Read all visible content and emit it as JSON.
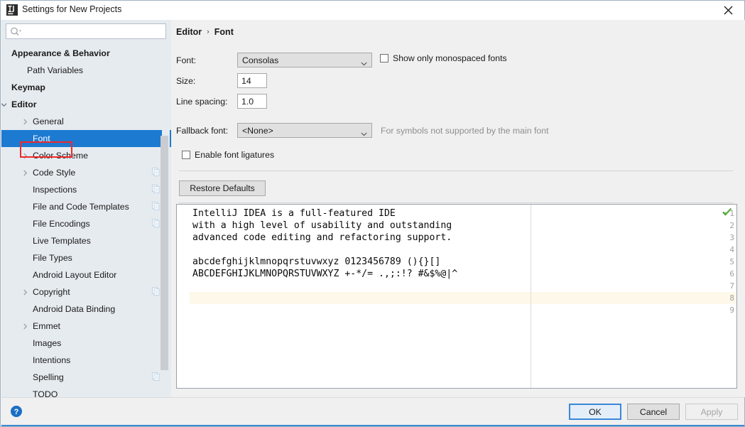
{
  "window": {
    "title": "Settings for New Projects",
    "app_icon": "intellij-idea-icon",
    "close_label": "✕"
  },
  "search": {
    "value": "",
    "placeholder": "",
    "icon": "search-icon"
  },
  "sidebar": {
    "items": [
      {
        "label": "Appearance & Behavior",
        "indent": 14,
        "bold": true,
        "arrow": "",
        "badge": false,
        "selected": false
      },
      {
        "label": "Path Variables",
        "indent": 36,
        "bold": false,
        "arrow": "",
        "badge": false,
        "selected": false
      },
      {
        "label": "Keymap",
        "indent": 14,
        "bold": true,
        "arrow": "",
        "badge": false,
        "selected": false
      },
      {
        "label": "Editor",
        "indent": 14,
        "bold": true,
        "arrow": "down",
        "badge": false,
        "selected": false
      },
      {
        "label": "General",
        "indent": 44,
        "bold": false,
        "arrow": "right",
        "badge": false,
        "selected": false
      },
      {
        "label": "Font",
        "indent": 44,
        "bold": false,
        "arrow": "",
        "badge": false,
        "selected": true
      },
      {
        "label": "Color Scheme",
        "indent": 44,
        "bold": false,
        "arrow": "right",
        "badge": false,
        "selected": false
      },
      {
        "label": "Code Style",
        "indent": 44,
        "bold": false,
        "arrow": "right",
        "badge": true,
        "selected": false
      },
      {
        "label": "Inspections",
        "indent": 44,
        "bold": false,
        "arrow": "",
        "badge": true,
        "selected": false
      },
      {
        "label": "File and Code Templates",
        "indent": 44,
        "bold": false,
        "arrow": "",
        "badge": true,
        "selected": false
      },
      {
        "label": "File Encodings",
        "indent": 44,
        "bold": false,
        "arrow": "",
        "badge": true,
        "selected": false
      },
      {
        "label": "Live Templates",
        "indent": 44,
        "bold": false,
        "arrow": "",
        "badge": false,
        "selected": false
      },
      {
        "label": "File Types",
        "indent": 44,
        "bold": false,
        "arrow": "",
        "badge": false,
        "selected": false
      },
      {
        "label": "Android Layout Editor",
        "indent": 44,
        "bold": false,
        "arrow": "",
        "badge": false,
        "selected": false
      },
      {
        "label": "Copyright",
        "indent": 44,
        "bold": false,
        "arrow": "right",
        "badge": true,
        "selected": false
      },
      {
        "label": "Android Data Binding",
        "indent": 44,
        "bold": false,
        "arrow": "",
        "badge": false,
        "selected": false
      },
      {
        "label": "Emmet",
        "indent": 44,
        "bold": false,
        "arrow": "right",
        "badge": false,
        "selected": false
      },
      {
        "label": "Images",
        "indent": 44,
        "bold": false,
        "arrow": "",
        "badge": false,
        "selected": false
      },
      {
        "label": "Intentions",
        "indent": 44,
        "bold": false,
        "arrow": "",
        "badge": false,
        "selected": false
      },
      {
        "label": "Spelling",
        "indent": 44,
        "bold": false,
        "arrow": "",
        "badge": true,
        "selected": false
      },
      {
        "label": "TODO",
        "indent": 44,
        "bold": false,
        "arrow": "",
        "badge": false,
        "selected": false
      }
    ]
  },
  "breadcrumb": {
    "root": "Editor",
    "separator": "›",
    "current": "Font"
  },
  "form": {
    "font_label": "Font:",
    "font_value": "Consolas",
    "monospaced_label": "Show only monospaced fonts",
    "monospaced_checked": false,
    "size_label": "Size:",
    "size_value": "14",
    "line_spacing_label": "Line spacing:",
    "line_spacing_value": "1.0",
    "fallback_label": "Fallback font:",
    "fallback_value": "<None>",
    "fallback_hint": "For symbols not supported by the main font",
    "ligatures_label": "Enable font ligatures",
    "ligatures_checked": false,
    "restore_defaults_label": "Restore Defaults"
  },
  "preview": {
    "line_numbers": [
      "1",
      "2",
      "3",
      "4",
      "5",
      "6",
      "7",
      "8",
      "9"
    ],
    "lines": [
      "IntelliJ IDEA is a full-featured IDE",
      "with a high level of usability and outstanding",
      "advanced code editing and refactoring support.",
      "",
      "abcdefghijklmnopqrstuvwxyz 0123456789 (){}[]",
      "ABCDEFGHIJKLMNOPQRSTUVWXYZ +-*/= .,;:!? #&$%@|^",
      "",
      "",
      ""
    ],
    "caret_line": 8,
    "status_icon": "green-check-icon"
  },
  "footer": {
    "help_icon": "help-question-icon",
    "ok_label": "OK",
    "cancel_label": "Cancel",
    "apply_label": "Apply",
    "apply_disabled": true
  },
  "colors": {
    "selection_blue": "#1c7ad1",
    "annotation_red": "#ef2a2a",
    "accent_bar": "#3c8ad0",
    "caret_line": "#fdf8e9",
    "ok_green": "#4a9e38"
  }
}
